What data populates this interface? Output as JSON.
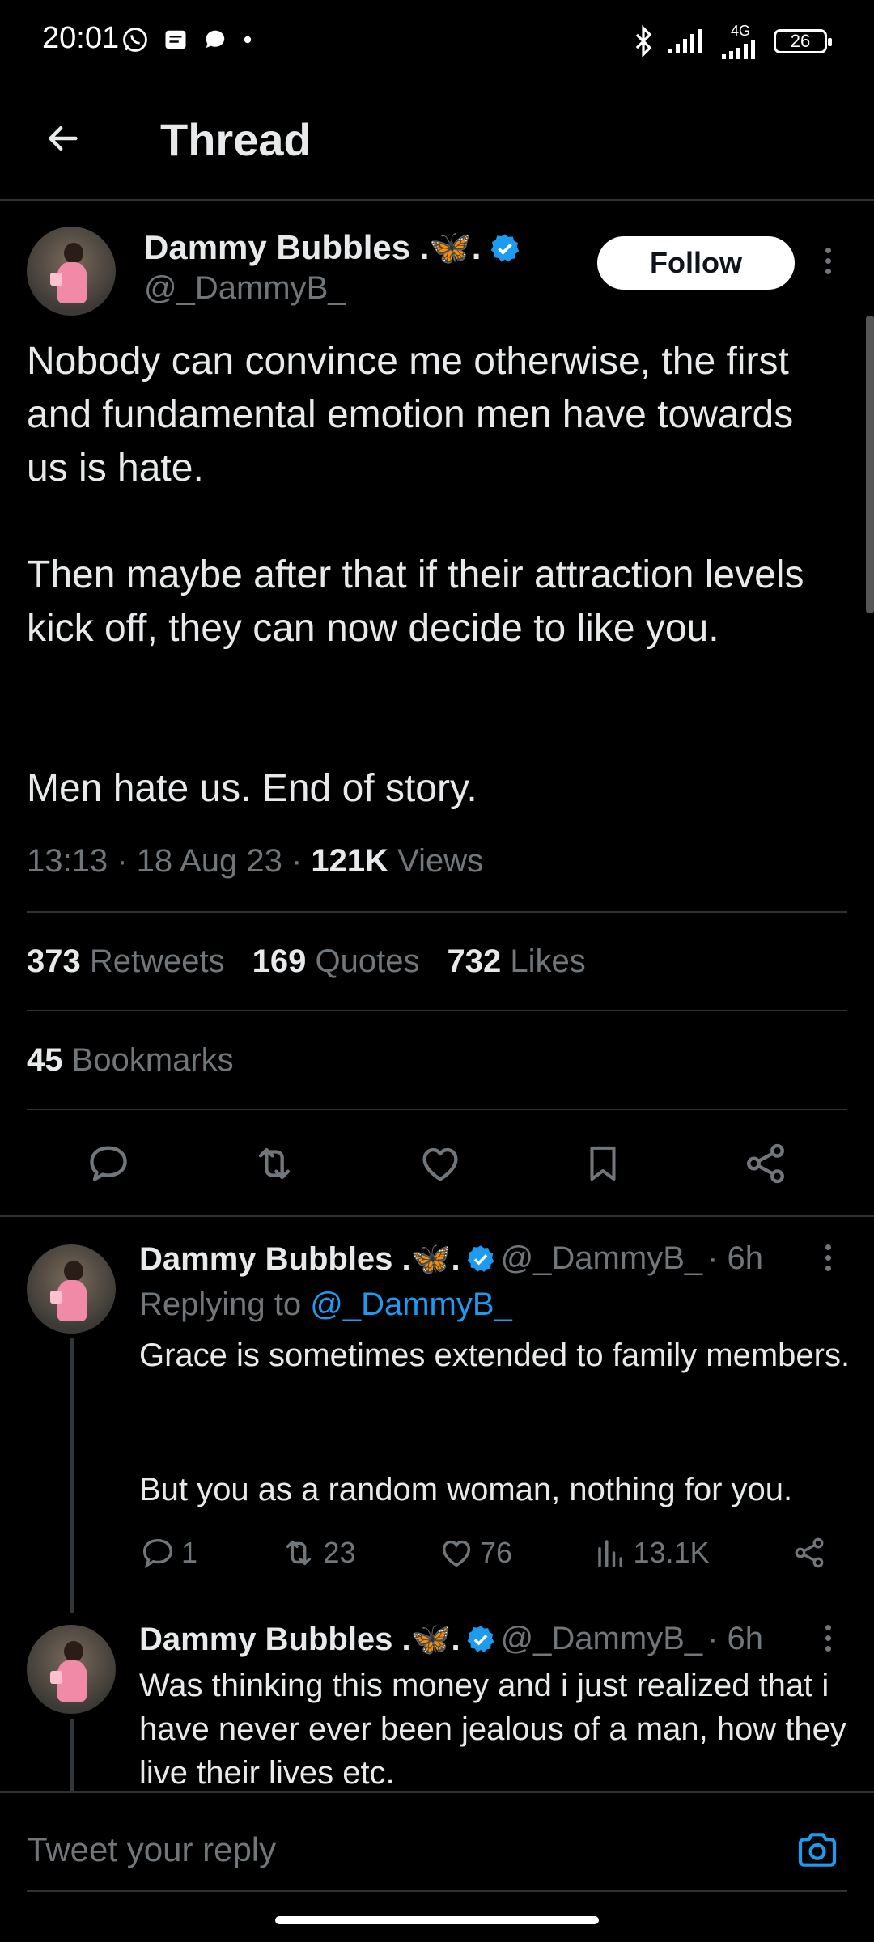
{
  "status_bar": {
    "time": "20:01",
    "network_label": "4G",
    "battery": "26"
  },
  "header": {
    "title": "Thread"
  },
  "main_tweet": {
    "author_name": "Dammy Bubbles .🦋.",
    "handle": "@_DammyB_",
    "follow_label": "Follow",
    "paragraphs": [
      "Nobody can convince me otherwise, the first and fundamental emotion men have towards us is hate.",
      "Then maybe after that if their attraction levels kick off, they can now decide to like you.",
      "Men hate us. End of story."
    ],
    "time": "13:13",
    "date": "18 Aug 23",
    "views_count": "121K",
    "views_label": "Views",
    "retweets_count": "373",
    "retweets_label": "Retweets",
    "quotes_count": "169",
    "quotes_label": "Quotes",
    "likes_count": "732",
    "likes_label": "Likes",
    "bookmarks_count": "45",
    "bookmarks_label": "Bookmarks"
  },
  "replies": [
    {
      "author_name": "Dammy Bubbles .🦋.",
      "handle": "@_DammyB_",
      "age": "· 6h",
      "replying_prefix": "Replying to",
      "replying_to": "@_DammyB_",
      "paragraphs": [
        "Grace is sometimes extended to family members.",
        "But you as a random woman, nothing for you."
      ],
      "replies_count": "1",
      "retweets_count": "23",
      "likes_count": "76",
      "views_count": "13.1K"
    },
    {
      "author_name": "Dammy Bubbles .🦋.",
      "handle": "@_DammyB_",
      "age": "· 6h",
      "paragraphs": [
        "Was thinking this money and i just realized that i have never ever been jealous of a man, how they live their lives etc."
      ]
    }
  ],
  "composer": {
    "placeholder": "Tweet your reply"
  },
  "colors": {
    "background": "#000000",
    "text": "#e7e9ea",
    "muted": "#71767b",
    "accent": "#1d9bf0",
    "divider": "#2f3336"
  },
  "icons": {
    "back": "arrow-left-icon",
    "verified": "verified-badge-icon",
    "more": "more-vertical-icon",
    "reply": "comment-icon",
    "retweet": "retweet-icon",
    "like": "heart-icon",
    "bookmark": "bookmark-icon",
    "share": "share-icon",
    "views": "analytics-icon",
    "camera": "camera-icon"
  }
}
